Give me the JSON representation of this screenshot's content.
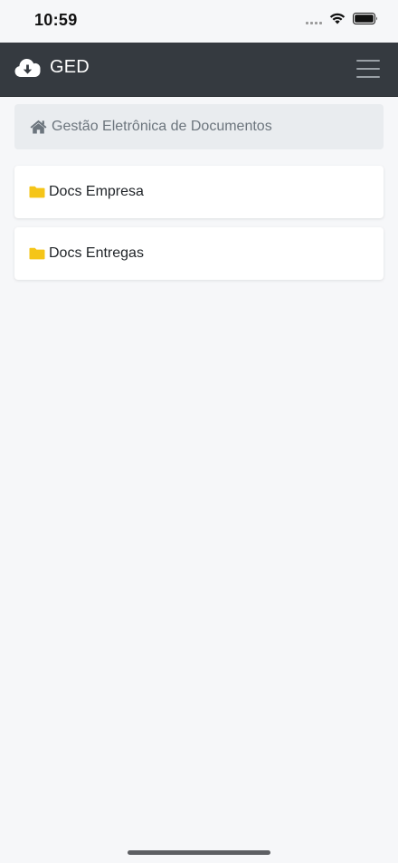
{
  "status_bar": {
    "time": "10:59"
  },
  "navbar": {
    "title": "GED",
    "logo_icon": "cloud-download-icon",
    "menu_icon": "hamburger-menu-icon",
    "background_color": "#353a40"
  },
  "breadcrumb": {
    "icon": "home-icon",
    "label": "Gestão Eletrônica de Documentos"
  },
  "folders": [
    {
      "icon": "folder-icon",
      "label": "Docs Empresa"
    },
    {
      "icon": "folder-icon",
      "label": "Docs Entregas"
    }
  ],
  "colors": {
    "folder_icon": "#f5c518",
    "breadcrumb_bg": "#e9ecef",
    "breadcrumb_text": "#6c757d"
  }
}
